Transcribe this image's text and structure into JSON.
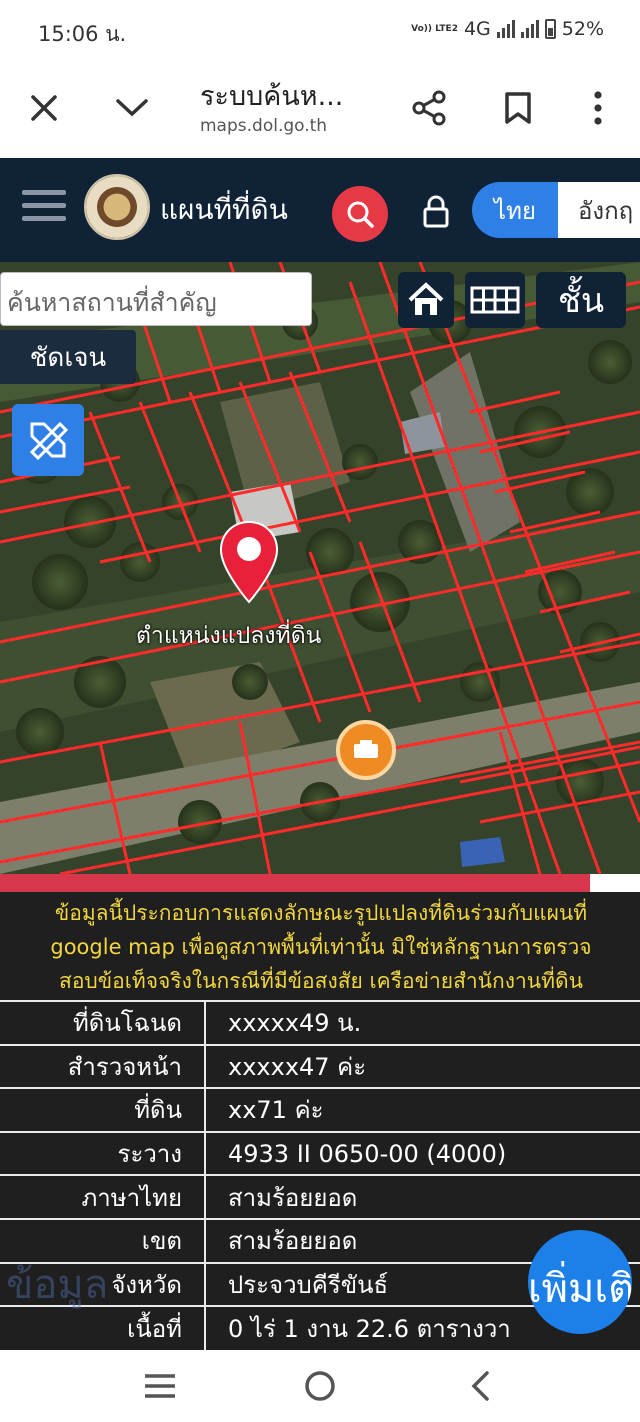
{
  "status": {
    "time": "15:06 น.",
    "volte": "Vo)) LTE2",
    "network": "4G",
    "battery": "52%"
  },
  "browser": {
    "title": "ระบบค้นห...",
    "url": "maps.dol.go.th",
    "icons": [
      "close-icon",
      "chevron-down-icon",
      "share-icon",
      "bookmark-icon",
      "more-vert-icon"
    ]
  },
  "header": {
    "title": "แผนที่ที่ดิน",
    "lang_th": "ไทย",
    "lang_en": "อังกฤ"
  },
  "map": {
    "search_placeholder": "ค้นหาสถานที่สำคัญ",
    "clear_label": "ชัดเจน",
    "layer_label": "ชั้น",
    "pin_label": "ตำแหน่งแปลงที่ดิน"
  },
  "info": {
    "notice": [
      "ข้อมูลนี้ประกอบการแสดงลักษณะรูปแปลงที่ดินร่วมกับแผนที่",
      "google map เพื่อดูสภาพพื้นที่เท่านั้น มิใช่หลักฐานการตรวจ",
      "สอบข้อเท็จจริงในกรณีที่มีข้อสงสัย เครือข่ายสำนักงานที่ดิน"
    ],
    "rows": [
      {
        "key": "ที่ดินโฉนด",
        "value": "xxxxx49 น."
      },
      {
        "key": "สำรวจหน้า",
        "value": "xxxxx47 ค่ะ"
      },
      {
        "key": "ที่ดิน",
        "value": "xx71 ค่ะ"
      },
      {
        "key": "ระวาง",
        "value": "4933 II 0650-00 (4000)"
      },
      {
        "key": "ภาษาไทย",
        "value": "สามร้อยยอด"
      },
      {
        "key": "เขต",
        "value": "สามร้อยยอด"
      },
      {
        "key": "จังหวัด",
        "value": "ประจวบคีรีขันธ์"
      },
      {
        "key": "เนื้อที่",
        "value": "0 ไร่ 1 งาน 22.6 ตารางวา"
      }
    ],
    "ghost_label": "ข้อมูล",
    "more_label": "เพิ่มเติ"
  },
  "colors": {
    "header_bg": "#0f2236",
    "accent_blue": "#2f80e6",
    "search_red": "#e63946",
    "parcel_line": "#ff2a2a",
    "notice_yellow": "#f2d641"
  }
}
